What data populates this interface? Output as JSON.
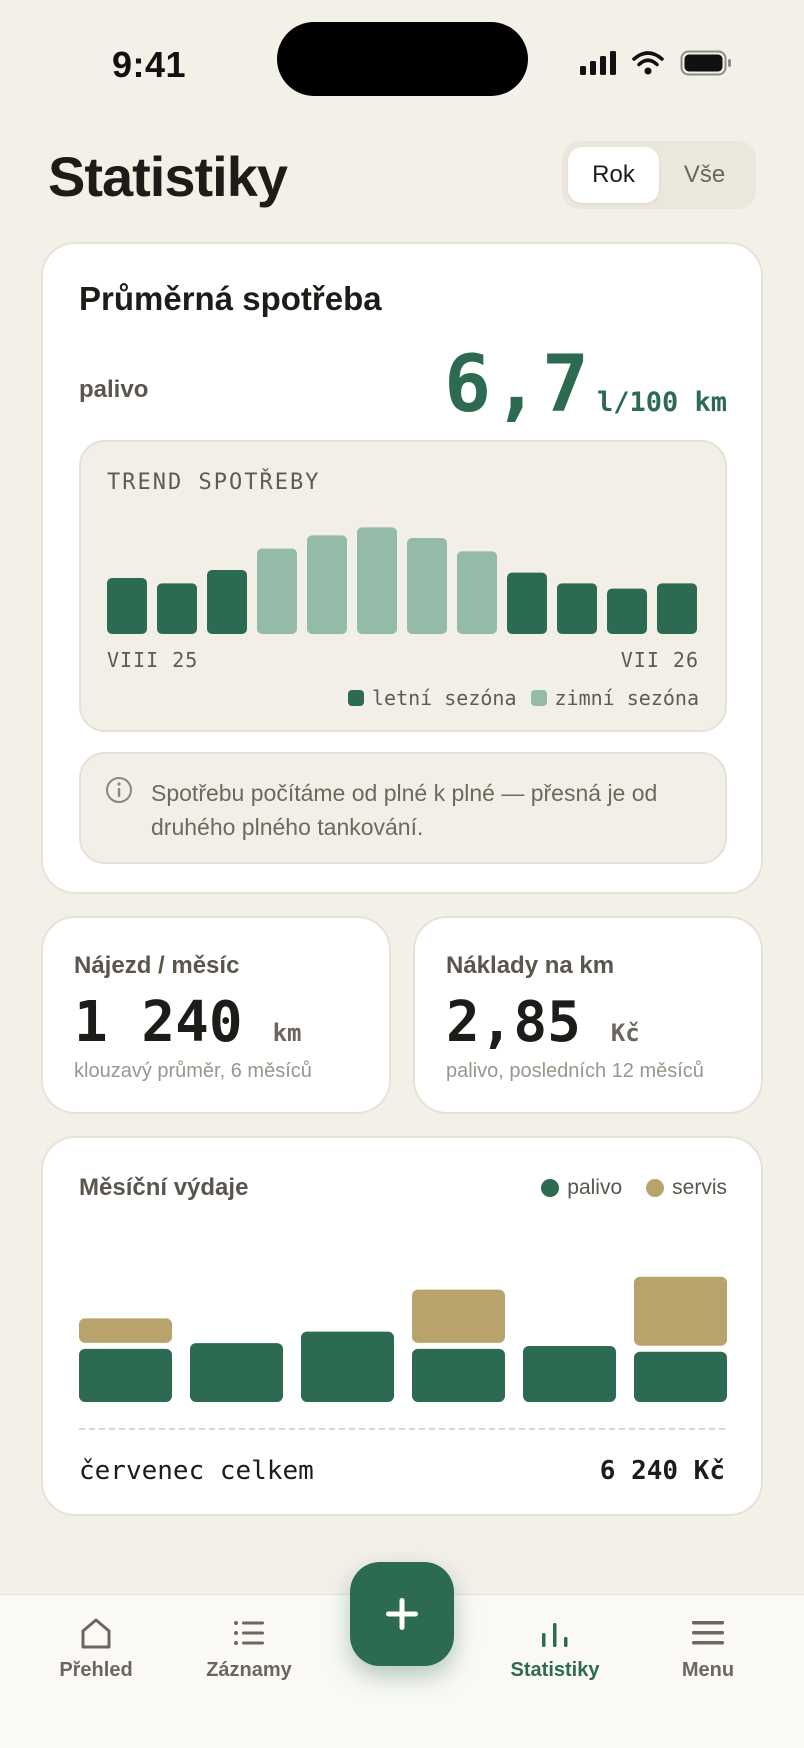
{
  "status_bar": {
    "time": "9:41"
  },
  "header": {
    "title": "Statistiky",
    "segments": [
      {
        "label": "Rok",
        "active": true
      },
      {
        "label": "Vše",
        "active": false
      }
    ]
  },
  "consumption": {
    "title": "Průměrná spotřeba",
    "fuel_label": "palivo",
    "value": "6,7",
    "unit": "l/100 km",
    "trend": {
      "label": "TREND SPOTŘEBY",
      "start_label": "VIII 25",
      "end_label": "VII 26",
      "legend": {
        "summer": "letní sezóna",
        "winter": "zimní sezóna"
      }
    },
    "info_text": "Spotřebu počítáme od plné k plné — přesná je od druhého plného tankování."
  },
  "mileage": {
    "label": "Nájezd / měsíc",
    "value": "1 240",
    "unit": "km",
    "note": "klouzavý průměr, 6 měsíců"
  },
  "cost_per_km": {
    "label": "Náklady na km",
    "value": "2,85",
    "unit": "Kč",
    "note": "palivo, posledních 12 měsíců"
  },
  "monthly_expenses": {
    "title": "Měsíční výdaje",
    "legend": {
      "fuel": "palivo",
      "service": "servis"
    },
    "total_label": "červenec celkem",
    "total_value": "6 240 Kč"
  },
  "chart_data": [
    {
      "type": "bar",
      "title": "TREND SPOTŘEBY",
      "x_start": "VIII 25",
      "x_end": "VII 26",
      "values": [
        6.6,
        6.4,
        6.9,
        7.7,
        8.2,
        8.5,
        8.1,
        7.6,
        6.8,
        6.4,
        6.2,
        6.4
      ],
      "season": [
        "letní",
        "letní",
        "letní",
        "zimní",
        "zimní",
        "zimní",
        "zimní",
        "zimní",
        "letní",
        "letní",
        "letní",
        "letní"
      ],
      "ylim": [
        4.5,
        8.7
      ],
      "series": [
        {
          "name": "letní sezóna",
          "color": "#2d6a52"
        },
        {
          "name": "zimní sezóna",
          "color": "#93bba7"
        }
      ]
    },
    {
      "type": "bar",
      "title": "Měsíční výdaje",
      "stacked": true,
      "series": [
        {
          "name": "palivo",
          "color": "#2d6a52",
          "values": [
            1850,
            2050,
            2450,
            1850,
            1950,
            1750
          ]
        },
        {
          "name": "servis",
          "color": "#b9a36c",
          "values": [
            850,
            0,
            0,
            1850,
            0,
            2400
          ]
        }
      ],
      "ylim": [
        0,
        6400
      ]
    }
  ],
  "nav": {
    "items": [
      {
        "label": "Přehled",
        "icon": "home-icon"
      },
      {
        "label": "Záznamy",
        "icon": "list-icon"
      },
      {
        "label": "Statistiky",
        "icon": "bar-chart-icon",
        "active": true
      },
      {
        "label": "Menu",
        "icon": "menu-icon"
      }
    ],
    "fab_icon": "plus-icon"
  },
  "colors": {
    "accent": "#2d6a52",
    "accent_light": "#93bba7",
    "service": "#b9a36c",
    "background": "#f3f0e8"
  }
}
